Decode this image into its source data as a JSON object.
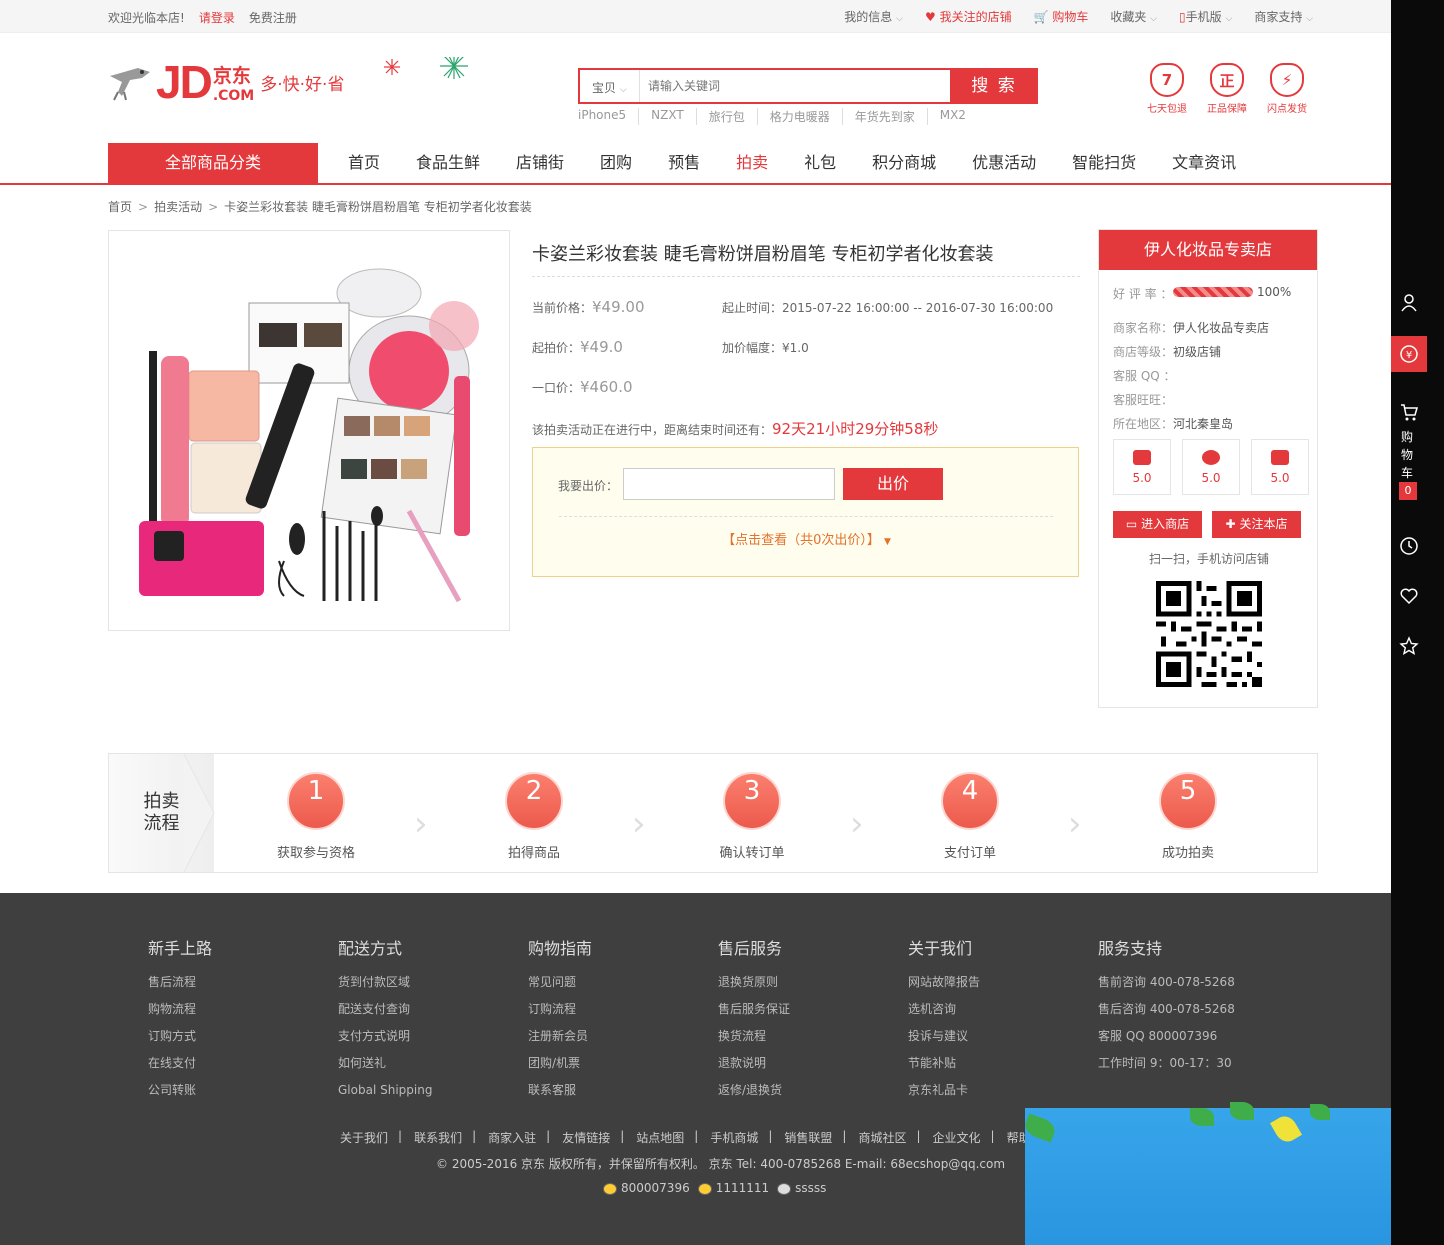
{
  "topbar": {
    "welcome": "欢迎光临本店!",
    "login": "请登录",
    "register": "免费注册",
    "my_info": "我的信息",
    "followed_shops": "我关注的店铺",
    "cart": "购物车",
    "favorites": "收藏夹",
    "mobile": "手机版",
    "merchant_support": "商家支持"
  },
  "header": {
    "logo_text": "JD",
    "logo_cn": "京东",
    "logo_com": ".COM",
    "slogan": "多·快·好·省",
    "search_category": "宝贝",
    "search_placeholder": "请输入关键词",
    "search_button": "搜 索",
    "hot_words": [
      "iPhone5",
      "NZXT",
      "旅行包",
      "格力电暖器",
      "年货先到家",
      "MX2"
    ],
    "guarantees": [
      {
        "icon": "7",
        "label": "七天包退"
      },
      {
        "icon": "正",
        "label": "正品保障"
      },
      {
        "icon": "⚡",
        "label": "闪点发货"
      }
    ]
  },
  "nav": {
    "all_categories": "全部商品分类",
    "items": [
      "首页",
      "食品生鲜",
      "店铺街",
      "团购",
      "预售",
      "拍卖",
      "礼包",
      "积分商城",
      "优惠活动",
      "智能扫货",
      "文章资讯"
    ],
    "active_index": 5
  },
  "breadcrumb": [
    "首页",
    "拍卖活动",
    "卡姿兰彩妆套装 睫毛膏粉饼眉粉眉笔 专柜初学者化妆套装"
  ],
  "product": {
    "title": "卡姿兰彩妆套装 睫毛膏粉饼眉粉眉笔 专柜初学者化妆套装",
    "current_price_label": "当前价格：",
    "current_price": "¥49.00",
    "time_label": "起止时间：",
    "time_range": "2015-07-22 16:00:00 -- 2016-07-30 16:00:00",
    "start_price_label": "起拍价：",
    "start_price": "¥49.0",
    "increment_label": "加价幅度：",
    "increment": "¥1.0",
    "buyout_label": "一口价：",
    "buyout_price": "¥460.0",
    "status_text": "该拍卖活动正在进行中，距离结束时间还有：",
    "countdown": "92天21小时29分钟58秒",
    "bid_label": "我要出价：",
    "bid_button": "出价",
    "view_bids": "【点击查看（共0次出价）】"
  },
  "shop": {
    "name": "伊人化妆品专卖店",
    "rating_label": "好 评 率 ：",
    "rating": "100%",
    "rating_fraction": 1.0,
    "merchant_label": "商家名称：",
    "merchant": "伊人化妆品专卖店",
    "level_label": "商店等级：",
    "level": "初级店铺",
    "qq_label": "客服 QQ ：",
    "wangwang_label": "客服旺旺：",
    "region_label": "所在地区：",
    "region": "河北秦皇岛",
    "scores": [
      "5.0",
      "5.0",
      "5.0"
    ],
    "enter_button": "进入商店",
    "follow_button": "关注本店",
    "scan_text": "扫一扫，手机访问店铺"
  },
  "process": {
    "label_line1": "拍卖",
    "label_line2": "流程",
    "steps": [
      {
        "num": "1",
        "label": "获取参与资格"
      },
      {
        "num": "2",
        "label": "拍得商品"
      },
      {
        "num": "3",
        "label": "确认转订单"
      },
      {
        "num": "4",
        "label": "支付订单"
      },
      {
        "num": "5",
        "label": "成功拍卖"
      }
    ]
  },
  "footer": {
    "columns": [
      {
        "title": "新手上路",
        "items": [
          "售后流程",
          "购物流程",
          "订购方式",
          "在线支付",
          "公司转账"
        ]
      },
      {
        "title": "配送方式",
        "items": [
          "货到付款区域",
          "配送支付查询",
          "支付方式说明",
          "如何送礼",
          "Global Shipping"
        ]
      },
      {
        "title": "购物指南",
        "items": [
          "常见问题",
          "订购流程",
          "注册新会员",
          "团购/机票",
          "联系客服"
        ]
      },
      {
        "title": "售后服务",
        "items": [
          "退换货原则",
          "售后服务保证",
          "换货流程",
          "退款说明",
          "返修/退换货"
        ]
      },
      {
        "title": "关于我们",
        "items": [
          "网站故障报告",
          "选机咨询",
          "投诉与建议",
          "节能补贴",
          "京东礼品卡"
        ]
      },
      {
        "title": "服务支持",
        "items": [
          "售前咨询 400-078-5268",
          "售后咨询 400-078-5268",
          "客服 QQ 800007396",
          "工作时间 9：00-17：30"
        ]
      }
    ],
    "links": [
      "关于我们",
      "联系我们",
      "商家入驻",
      "友情链接",
      "站点地图",
      "手机商城",
      "销售联盟",
      "商城社区",
      "企业文化",
      "帮助中心"
    ],
    "copyright": "© 2005-2016 京东 版权所有，并保留所有权利。 京东 Tel: 400-0785268 E-mail: 68ecshop@qq.com",
    "qq1": "800007396",
    "qq2": "1111111",
    "ww": "sssss"
  },
  "rightbar": {
    "cart_label": [
      "购",
      "物",
      "车"
    ],
    "cart_count": "0"
  },
  "colors": {
    "brand": "#e4393c",
    "footer_bg": "#3f3f3f",
    "sidebar_bg": "#0a0a0a"
  }
}
